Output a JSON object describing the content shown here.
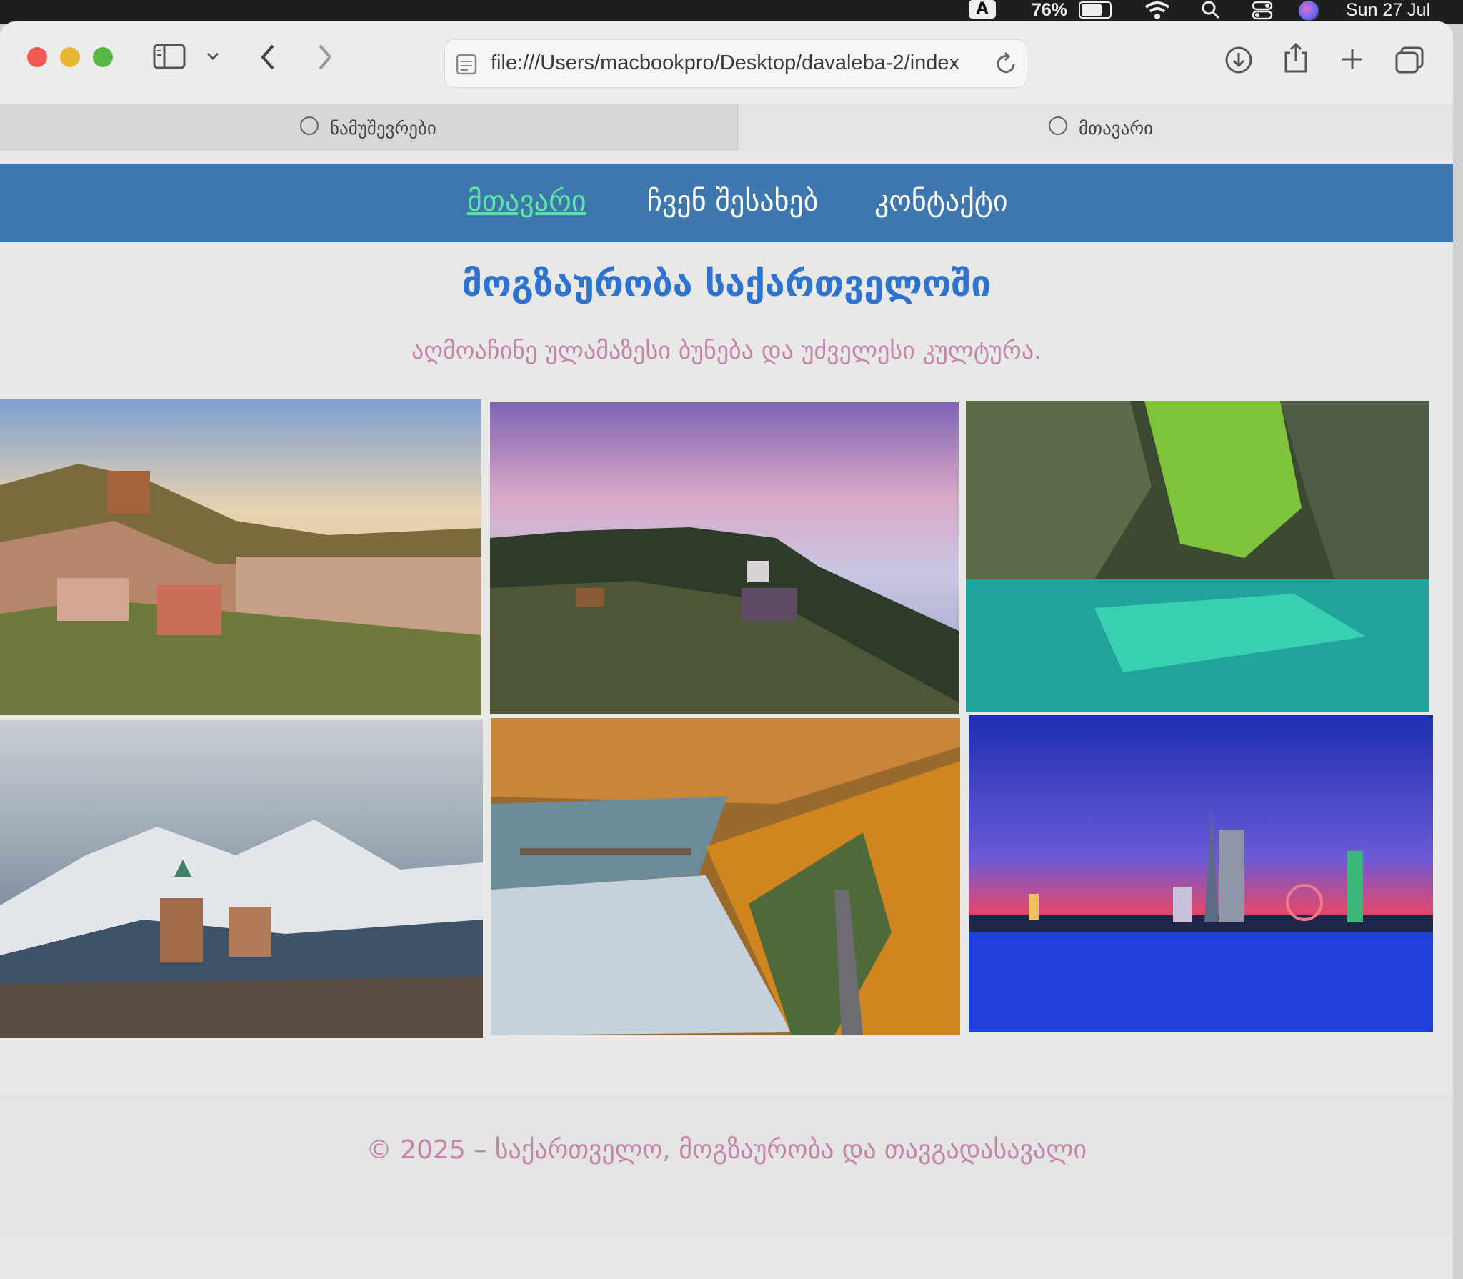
{
  "menubar": {
    "keyboard_badge": "A",
    "battery_percent": "76%",
    "date": "Sun 27 Jul",
    "icons": [
      "battery-icon",
      "wifi-icon",
      "spotlight-search-icon",
      "control-center-icon",
      "siri-icon"
    ]
  },
  "browser": {
    "url": "file:///Users/macbookpro/Desktop/davaleba-2/index",
    "tabs": [
      {
        "label": "ნამუშევრები",
        "active": true
      },
      {
        "label": "მთავარი",
        "active": false
      }
    ],
    "icons": [
      "sidebar-icon",
      "chevron-down-icon",
      "back-icon",
      "forward-icon",
      "page-icon",
      "reload-icon",
      "download-icon",
      "share-icon",
      "new-tab-icon",
      "tab-overview-icon"
    ]
  },
  "site": {
    "nav": [
      {
        "label": "მთავარი",
        "active": true
      },
      {
        "label": "ჩვენ შესახებ",
        "active": false
      },
      {
        "label": "კონტაქტი",
        "active": false
      }
    ],
    "heading": "მოგზაურობა საქართველოში",
    "subtitle": "აღმოაჩინე ულამაზესი ბუნება და უძველესი კულტურა.",
    "gallery": [
      {
        "name": "old-tbilisi-photo"
      },
      {
        "name": "misty-highland-village-photo"
      },
      {
        "name": "green-canyon-river-photo"
      },
      {
        "name": "snowy-mountain-church-photo"
      },
      {
        "name": "autumn-lake-forest-photo"
      },
      {
        "name": "batumi-night-skyline-photo"
      }
    ],
    "footer": "© 2025 – საქართველო, მოგზაურობა და თავგადასავალი"
  }
}
